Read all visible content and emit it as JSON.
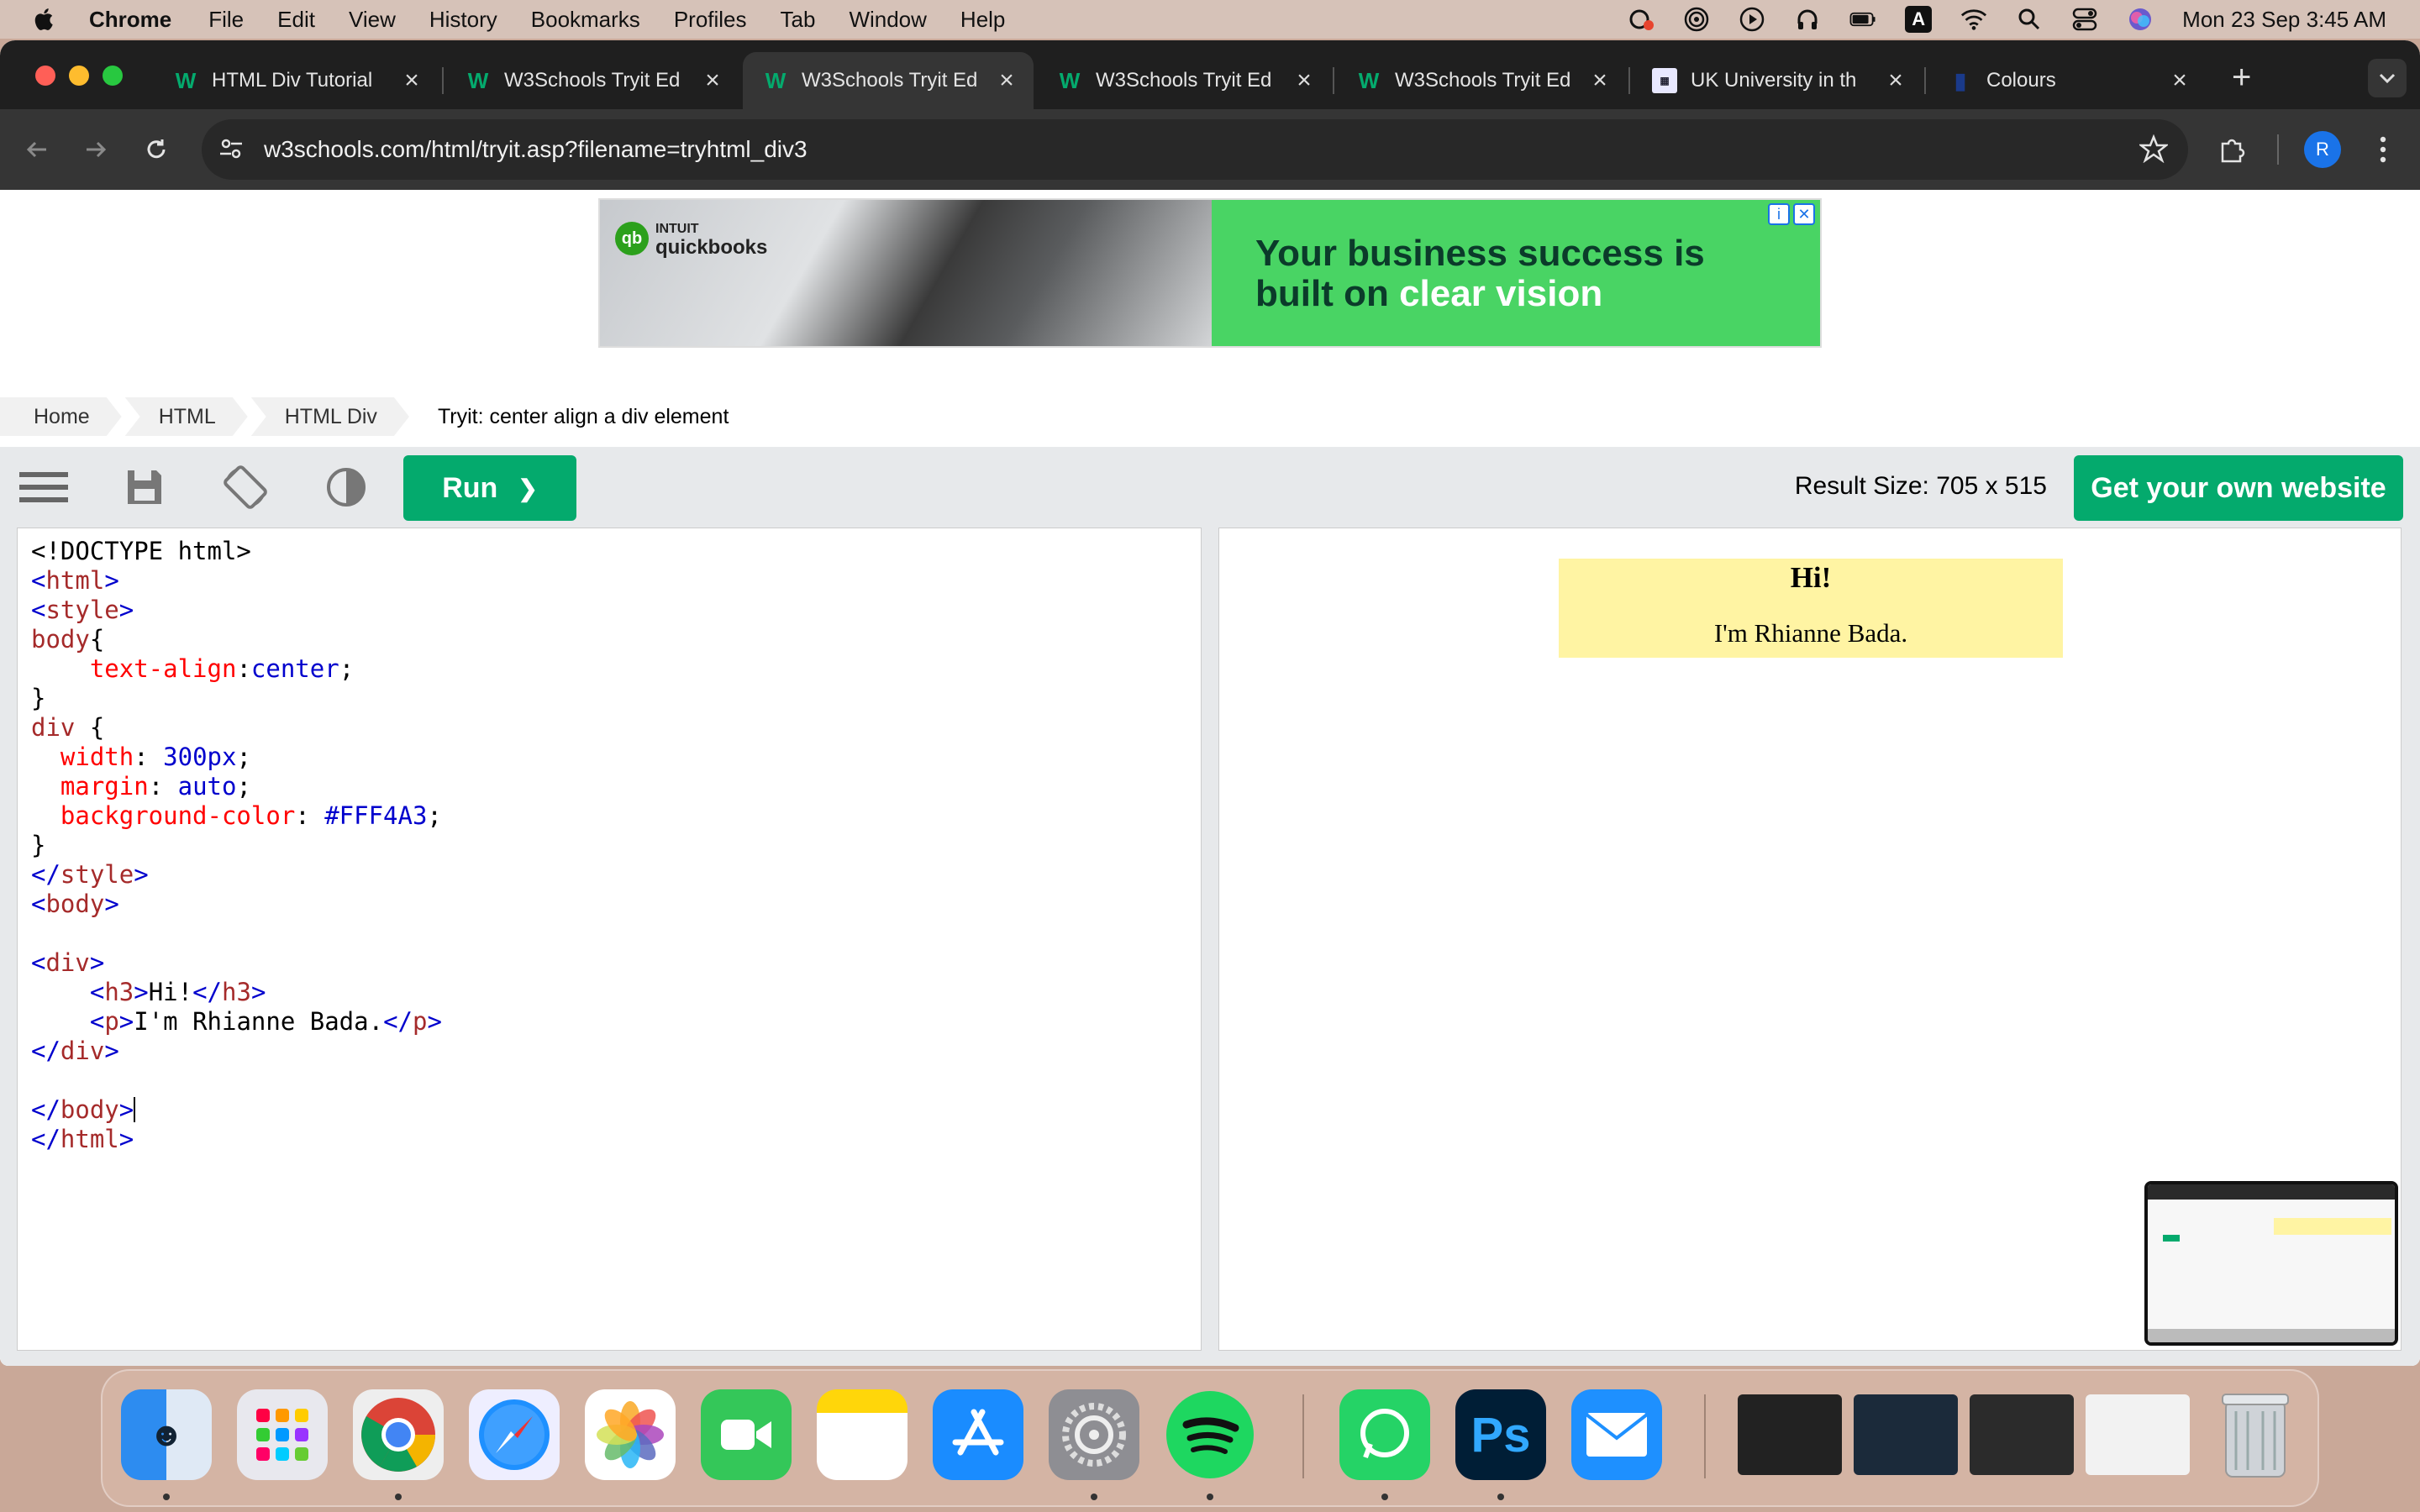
{
  "menubar": {
    "app": "Chrome",
    "items": [
      "File",
      "Edit",
      "View",
      "History",
      "Bookmarks",
      "Profiles",
      "Tab",
      "Window",
      "Help"
    ],
    "clock": "Mon 23 Sep  3:45 AM",
    "status_icons": [
      "creative-cloud-icon",
      "airdrop-icon",
      "play-icon",
      "headphones-icon",
      "battery-icon",
      "input-source-icon",
      "wifi-icon",
      "spotlight-icon",
      "control-center-icon",
      "siri-icon"
    ],
    "input_source": "A"
  },
  "tabs": [
    {
      "title": "HTML Div Tutorial",
      "favicon": "w3schools-icon",
      "active": false
    },
    {
      "title": "W3Schools Tryit Ed",
      "favicon": "w3schools-icon",
      "active": false
    },
    {
      "title": "W3Schools Tryit Ed",
      "favicon": "w3schools-icon",
      "active": true
    },
    {
      "title": "W3Schools Tryit Ed",
      "favicon": "w3schools-icon",
      "active": false
    },
    {
      "title": "W3Schools Tryit Ed",
      "favicon": "w3schools-icon",
      "active": false
    },
    {
      "title": "UK University in th",
      "favicon": "university-icon",
      "active": false
    },
    {
      "title": "Colours",
      "favicon": "bookmark-icon",
      "active": false
    }
  ],
  "toolbar": {
    "url": "w3schools.com/html/tryit.asp?filename=tryhtml_div3",
    "profile_initial": "R"
  },
  "ad": {
    "brand_line1": "INTUIT",
    "brand_line2": "quickbooks",
    "logo_text": "qb",
    "headline_line1": "Your business success is",
    "headline_line2_plain": "built on ",
    "headline_line2_highlight": "clear vision",
    "info_icon": "i",
    "close_icon": "✕"
  },
  "breadcrumb": [
    "Home",
    "HTML",
    "HTML Div",
    "Tryit: center align a div element"
  ],
  "tryit": {
    "run_label": "Run",
    "run_chevron": "❯",
    "result_size": "Result Size: 705 x 515",
    "get_website": "Get your own website"
  },
  "result": {
    "heading": "Hi!",
    "paragraph": "I'm Rhianne Bada.",
    "div_background": "#FFF4A3"
  },
  "colors": {
    "accent": "#04AA6D",
    "ad_green": "#49D464",
    "tab_bar": "#1F1F1F"
  }
}
